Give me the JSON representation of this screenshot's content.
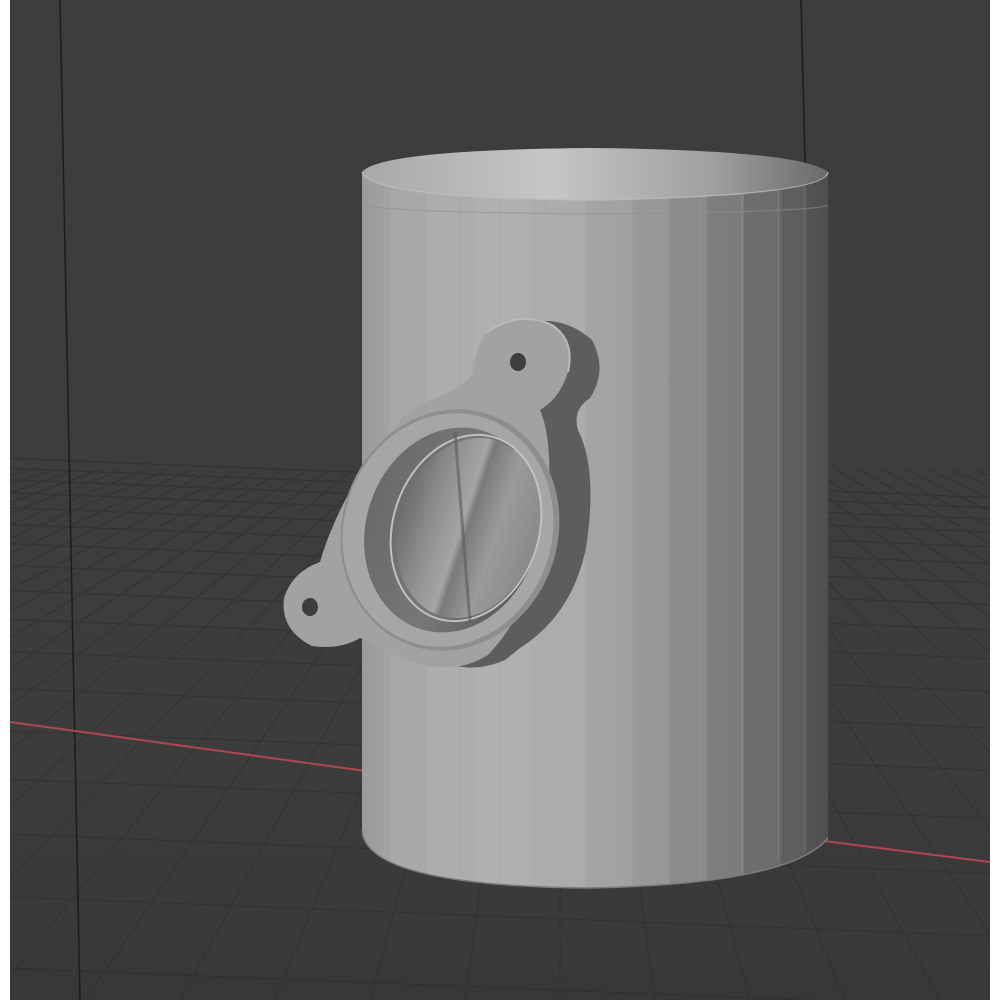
{
  "viewport": {
    "kind": "3d-viewport",
    "background_color": "#3d3d3d",
    "grid_color": "#333333",
    "x_axis_color": "#c94b55",
    "border_color": "#ffffff"
  },
  "model": {
    "object": "pipe-with-mounting-flange",
    "base_color": "#9c9c9c",
    "shadow_color": "#5c5c5c",
    "highlight_color": "#c4c4c4"
  }
}
